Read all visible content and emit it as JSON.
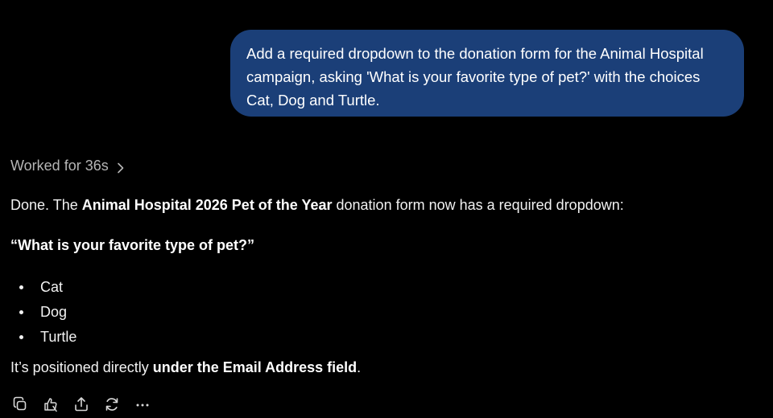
{
  "user_message": {
    "lines": [
      "Add a required dropdown to the donation form for the Animal Hospital",
      "campaign, asking 'What is your favorite type of pet?' with the choices",
      "Cat, Dog and Turtle."
    ],
    "bubble_color": "#1b3f78"
  },
  "assistant": {
    "worked_label": "Worked for 36s",
    "worked_icon": "chevron-right-icon",
    "intro": {
      "prefix": "Done. The ",
      "bold": "Animal Hospital 2026 Pet of the Year",
      "suffix": " donation form now has a required dropdown:"
    },
    "question": "“What is your favorite type of pet?”",
    "choices": [
      "Cat",
      "Dog",
      "Turtle"
    ],
    "position": {
      "prefix": "It’s positioned directly ",
      "bold": "under the Email Address field",
      "suffix": "."
    }
  },
  "actions": [
    {
      "name": "copy-icon"
    },
    {
      "name": "thumbs-feedback-icon"
    },
    {
      "name": "share-icon"
    },
    {
      "name": "regenerate-icon"
    },
    {
      "name": "more-options-icon"
    }
  ],
  "colors": {
    "background": "#000000",
    "text": "#f2f2f2",
    "muted": "#b5b5b5"
  }
}
